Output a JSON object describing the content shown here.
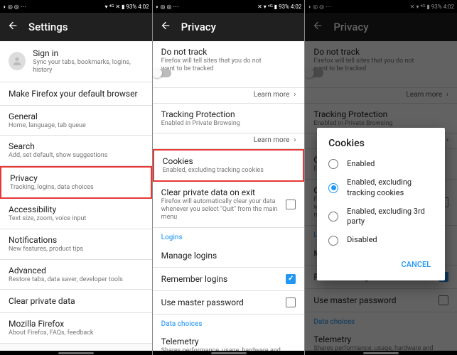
{
  "status": {
    "left_icons": "◗ ◎ ◎ ⋯",
    "right_icons": "▾ ⁴ᴳ ✕ ▮ 93% 4:02",
    "right_icons2": "✕ ▾ ⁴ᴳ ▮ 93% 4:02"
  },
  "screen1": {
    "title": "Settings",
    "items": {
      "signin_title": "Sign in",
      "signin_sub": "Sync your tabs, bookmarks, logins, history",
      "default_browser": "Make Firefox your default browser",
      "general_title": "General",
      "general_sub": "Home, language, tab queue",
      "search_title": "Search",
      "search_sub": "Add, set default, show suggestions",
      "privacy_title": "Privacy",
      "privacy_sub": "Tracking, logins, data choices",
      "accessibility_title": "Accessibility",
      "accessibility_sub": "Text size, zoom, voice input",
      "notifications_title": "Notifications",
      "notifications_sub": "New features, product tips",
      "advanced_title": "Advanced",
      "advanced_sub": "Restore tabs, data saver, developer tools",
      "clear_private": "Clear private data",
      "mozilla_title": "Mozilla Firefox",
      "mozilla_sub": "About Firefox, FAQs, feedback"
    }
  },
  "screen2": {
    "title": "Privacy",
    "dnt_title": "Do not track",
    "dnt_sub": "Firefox will tell sites that you do not want to be tracked",
    "learn_more": "Learn more",
    "tracking_title": "Tracking Protection",
    "tracking_sub": "Enabled in Private Browsing",
    "cookies_title": "Cookies",
    "cookies_sub": "Enabled, excluding tracking cookies",
    "clear_exit_title": "Clear private data on exit",
    "clear_exit_sub": "Firefox will automatically clear your data whenever you select \"Quit\" from the main menu",
    "logins_label": "Logins",
    "manage_logins": "Manage logins",
    "remember_logins": "Remember logins",
    "master_pw": "Use master password",
    "data_choices_label": "Data choices",
    "telemetry_title": "Telemetry",
    "telemetry_sub": "Shares performance, usage, hardware and"
  },
  "screen3": {
    "title": "Privacy",
    "dialog_title": "Cookies",
    "opt1": "Enabled",
    "opt2": "Enabled, excluding tracking cookies",
    "opt3": "Enabled, excluding 3rd party",
    "opt4": "Disabled",
    "cancel": "CANCEL"
  }
}
